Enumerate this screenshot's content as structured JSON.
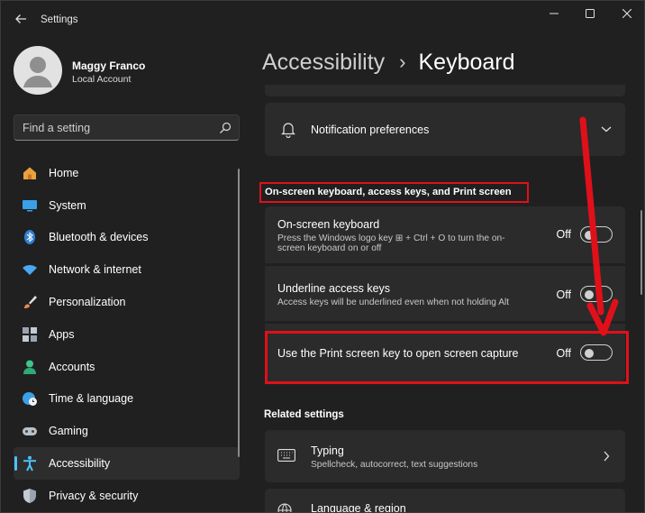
{
  "window": {
    "title": "Settings"
  },
  "profile": {
    "name": "Maggy Franco",
    "account_type": "Local Account"
  },
  "search": {
    "placeholder": "Find a setting"
  },
  "sidebar": {
    "items": [
      {
        "label": "Home",
        "icon": "home-icon",
        "active": false
      },
      {
        "label": "System",
        "icon": "system-icon",
        "active": false
      },
      {
        "label": "Bluetooth & devices",
        "icon": "bluetooth-icon",
        "active": false
      },
      {
        "label": "Network & internet",
        "icon": "wifi-icon",
        "active": false
      },
      {
        "label": "Personalization",
        "icon": "brush-icon",
        "active": false
      },
      {
        "label": "Apps",
        "icon": "apps-icon",
        "active": false
      },
      {
        "label": "Accounts",
        "icon": "accounts-icon",
        "active": false
      },
      {
        "label": "Time & language",
        "icon": "clock-globe-icon",
        "active": false
      },
      {
        "label": "Gaming",
        "icon": "gamepad-icon",
        "active": false
      },
      {
        "label": "Accessibility",
        "icon": "accessibility-icon",
        "active": true
      },
      {
        "label": "Privacy & security",
        "icon": "shield-icon",
        "active": false
      }
    ]
  },
  "breadcrumb": {
    "parent": "Accessibility",
    "separator": "›",
    "current": "Keyboard"
  },
  "notification": {
    "label": "Notification preferences"
  },
  "onscreen_section": {
    "heading": "On-screen keyboard, access keys, and Print screen",
    "rows": [
      {
        "title": "On-screen keyboard",
        "description_line1": "Press the Windows logo key ⊞ + Ctrl + O to turn the on-",
        "description_line2": "screen keyboard on or off",
        "state": "Off"
      },
      {
        "title": "Underline access keys",
        "description_line1": "Access keys will be underlined even when not holding Alt",
        "state": "Off"
      },
      {
        "title": "Use the Print screen key to open screen capture",
        "state": "Off"
      }
    ]
  },
  "related": {
    "heading": "Related settings",
    "typing": {
      "title": "Typing",
      "description": "Spellcheck, autocorrect, text suggestions"
    },
    "language": {
      "title": "Language & region"
    }
  },
  "colors": {
    "background": "#202020",
    "card": "#2b2b2b",
    "accent": "#4cc2ff",
    "annotation_red": "#e0101a"
  }
}
